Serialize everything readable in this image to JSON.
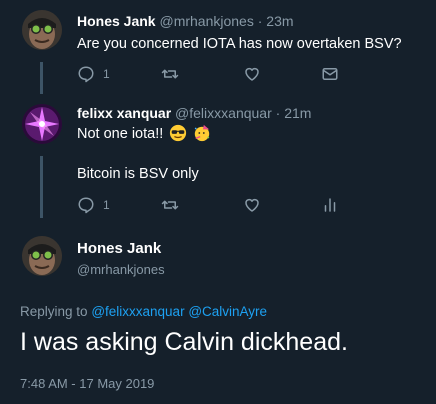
{
  "thread": [
    {
      "name": "Hones Jank",
      "handle": "@mrhankjones",
      "time": "· 23m",
      "text": "Are you concerned IOTA has now overtaken BSV?",
      "reply_count": "1",
      "icons": [
        "reply-icon",
        "retweet-icon",
        "like-icon",
        "message-icon"
      ]
    },
    {
      "name": "felixx xanquar",
      "handle": "@felixxxanquar",
      "time": "· 21m",
      "text_line1": "Not one iota!!",
      "text_line2": "Bitcoin is BSV only",
      "emojis": [
        "sunglasses-emoji",
        "party-face-emoji"
      ],
      "reply_count": "1",
      "icons": [
        "reply-icon",
        "retweet-icon",
        "like-icon",
        "analytics-icon"
      ]
    }
  ],
  "focused": {
    "name": "Hones Jank",
    "handle": "@mrhankjones",
    "replying_prefix": "Replying to",
    "mention1": "@felixxxanquar",
    "mention2": "@CalvinAyre",
    "text": "I was asking Calvin dickhead.",
    "timestamp": "7:48 AM - 17 May 2019"
  },
  "colors": {
    "background": "#15202b",
    "secondary_text": "#8899a6",
    "link": "#1da1f2",
    "thread_line": "#3d5466"
  }
}
